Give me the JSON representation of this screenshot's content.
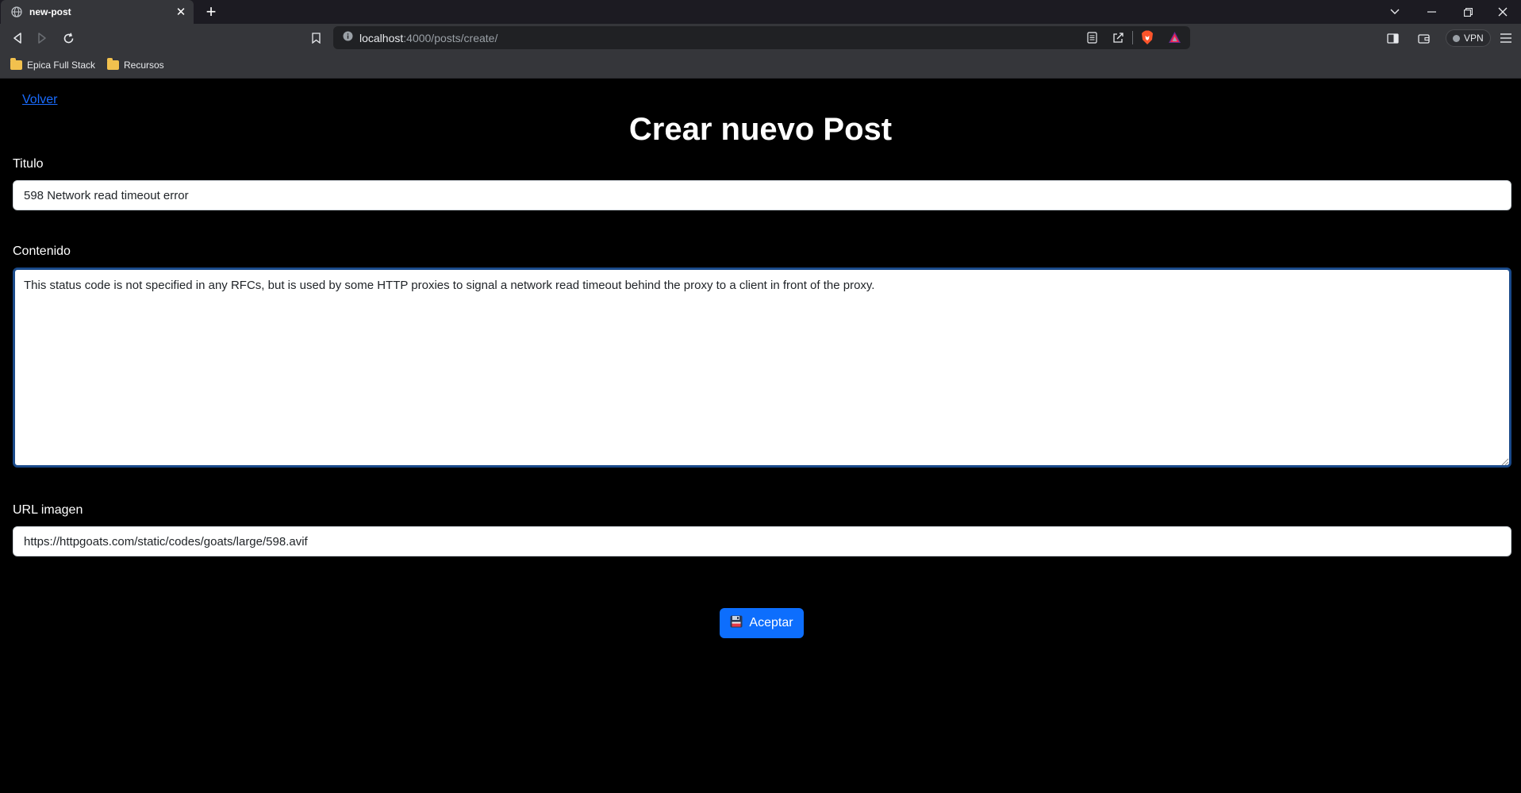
{
  "browser": {
    "tab_title": "new-post",
    "tab_close": "✕",
    "new_tab": "+",
    "url_host": "localhost",
    "url_path": ":4000/posts/create/",
    "vpn_label": "VPN",
    "bookmarks": [
      {
        "label": "Epica Full Stack"
      },
      {
        "label": "Recursos"
      }
    ]
  },
  "page": {
    "back_link": "Volver",
    "title": "Crear nuevo Post",
    "title_label": "Titulo",
    "title_value": "598 Network read timeout error",
    "content_label": "Contenido",
    "content_value": "This status code is not specified in any RFCs, but is used by some HTTP proxies to signal a network read timeout behind the proxy to a client in front of the proxy. ",
    "image_label": "URL imagen",
    "image_value": "https://httpgoats.com/static/codes/goats/large/598.avif",
    "submit_label": "Aceptar"
  },
  "colors": {
    "accent": "#0d6efd",
    "link": "#1a6cff",
    "textarea_focus": "#1a4a8a",
    "brave_orange": "#fb542b"
  }
}
